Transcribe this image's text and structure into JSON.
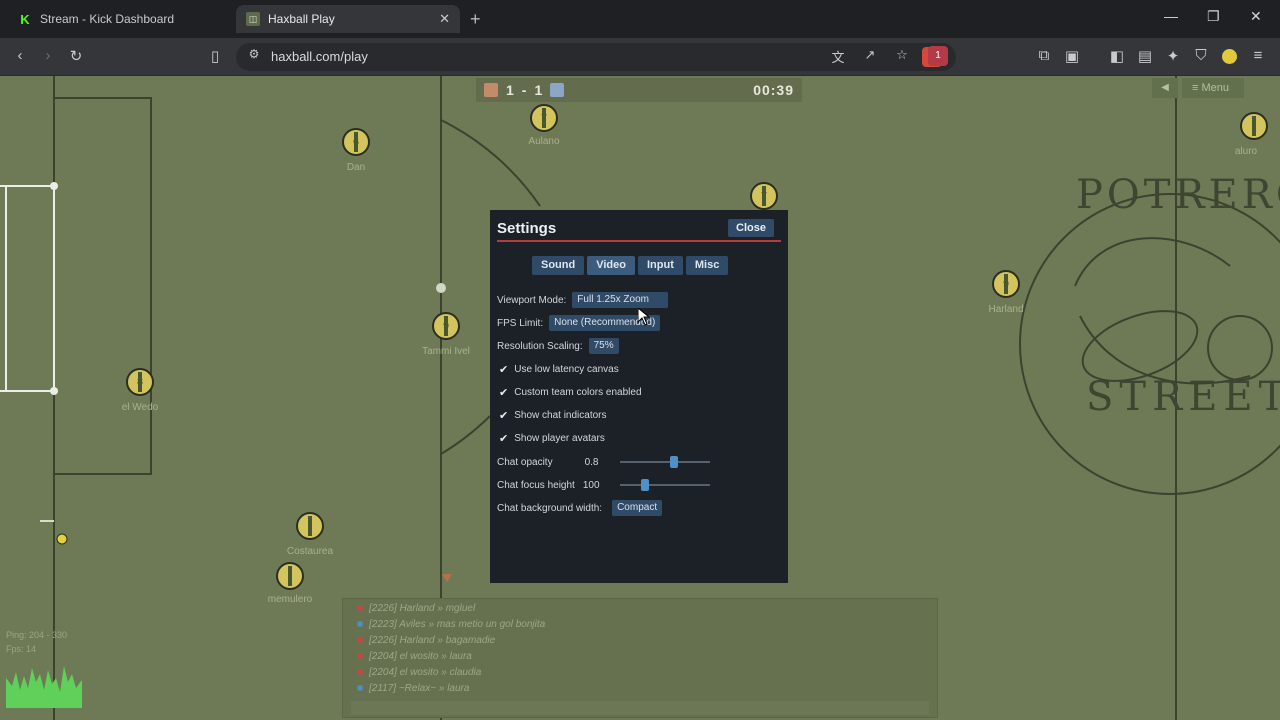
{
  "browser": {
    "tabs": [
      {
        "title": "Stream - Kick Dashboard",
        "favicon": "K",
        "active": false
      },
      {
        "title": "Haxball Play",
        "favicon": "◫",
        "active": true
      }
    ],
    "url": "haxball.com/play",
    "extension_badge": "1"
  },
  "game": {
    "score": {
      "red": "1",
      "separator": "-",
      "blue": "1",
      "time": "00:39"
    },
    "menu_label": "≡ Menu",
    "players": [
      {
        "name": "Dan",
        "num": "6"
      },
      {
        "name": "Aulano",
        "num": "7"
      },
      {
        "name": "Tammi Ivel",
        "num": "9"
      },
      {
        "name": "el Wedo",
        "num": "8"
      },
      {
        "name": "Costaurea",
        "num": ""
      },
      {
        "name": "memulero",
        "num": ""
      },
      {
        "name": "Harland",
        "num": "9"
      },
      {
        "name": "",
        "num": "7"
      },
      {
        "name": "aluro",
        "num": ""
      }
    ],
    "stadium_text_top": "POTRERO",
    "stadium_text_bottom": "STREET",
    "stats_ping": "Ping: 204 - 330",
    "stats_fps": "Fps: 14"
  },
  "settings": {
    "title": "Settings",
    "close_label": "Close",
    "tabs": [
      "Sound",
      "Video",
      "Input",
      "Misc"
    ],
    "viewport_label": "Viewport Mode:",
    "viewport_value": "Full 1.25x Zoom",
    "fps_label": "FPS Limit:",
    "fps_value": "None (Recommended)",
    "resolution_label": "Resolution Scaling:",
    "resolution_value": "75%",
    "checks": [
      "Use low latency canvas",
      "Custom team colors enabled",
      "Show chat indicators",
      "Show player avatars"
    ],
    "chat_opacity_label": "Chat opacity",
    "chat_opacity_value": "0.8",
    "chat_focus_label": "Chat focus height",
    "chat_focus_value": "100",
    "chat_bg_label": "Chat background width:",
    "chat_bg_value": "Compact"
  },
  "chat": {
    "lines": [
      {
        "text": "[2226] Harland » mgluel",
        "team": "red"
      },
      {
        "text": "[2223] Aviles » mas metio un gol bonjita",
        "team": "blue"
      },
      {
        "text": "[2226] Harland » bagamadie",
        "team": "red"
      },
      {
        "text": "[2204] el wosito » laura",
        "team": "red"
      },
      {
        "text": "[2204] el wosito » claudia",
        "team": "red"
      },
      {
        "text": "[2117] ~Relax~ » laura",
        "team": "blue"
      }
    ]
  },
  "colors": {
    "pitch": "#6e7a55",
    "red_team": "#c64646",
    "blue_team": "#4f8dbd",
    "accent": "#2f4b68"
  }
}
